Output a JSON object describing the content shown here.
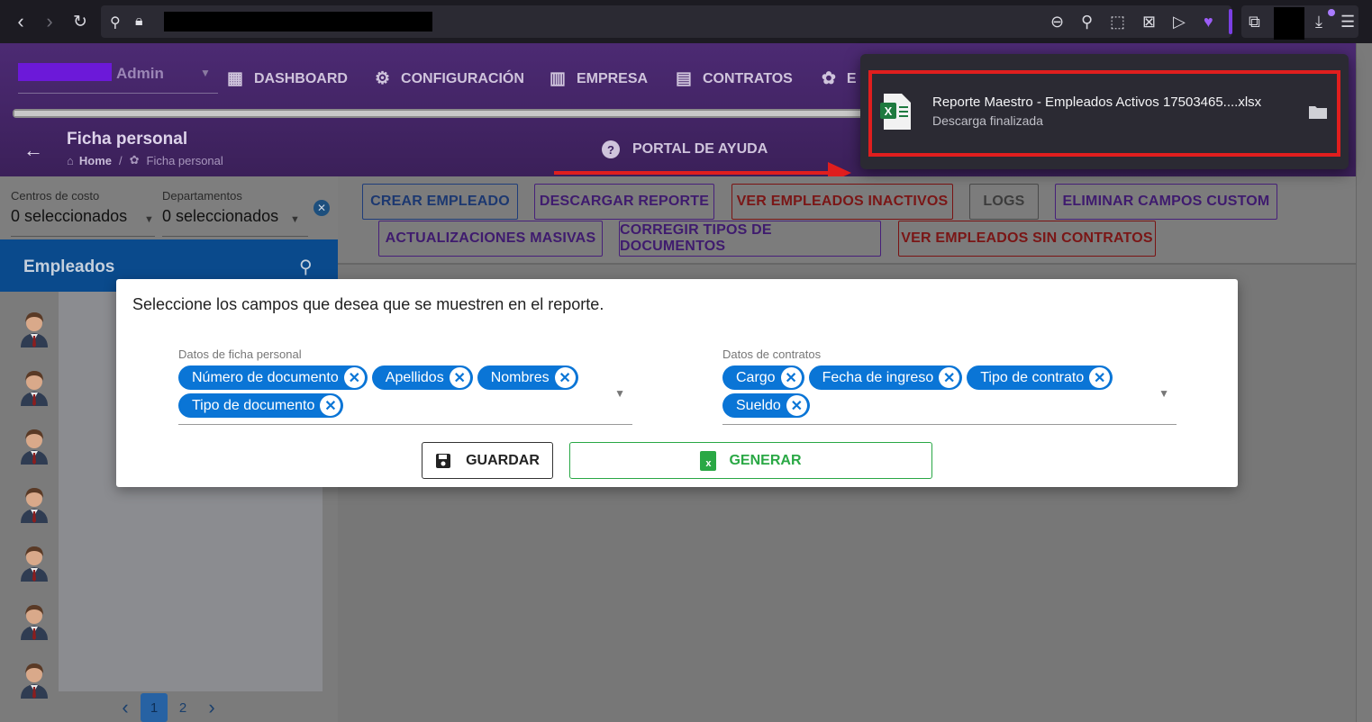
{
  "browser": {
    "url_redacted": true
  },
  "app": {
    "user_name": "Admin",
    "menu": [
      {
        "label": "DASHBOARD",
        "icon": "dashboard-icon"
      },
      {
        "label": "CONFIGURACIÓN",
        "icon": "gear-icon"
      },
      {
        "label": "EMPRESA",
        "icon": "building-icon"
      },
      {
        "label": "CONTRATOS",
        "icon": "clipboard-icon"
      },
      {
        "label": "E",
        "icon": "palette-icon"
      }
    ],
    "page_title": "Ficha personal",
    "breadcrumb": {
      "home": "Home",
      "current": "Ficha personal"
    },
    "help_portal": "PORTAL DE AYUDA"
  },
  "filters": {
    "centros_label": "Centros de costo",
    "centros_value": "0 seleccionados",
    "departamentos_label": "Departamentos",
    "departamentos_value": "0 seleccionados"
  },
  "employees": {
    "title": "Empleados",
    "avatar_count": 7,
    "pagination": {
      "prev": "‹",
      "pages": [
        "1",
        "2"
      ],
      "active": "1",
      "next": "›"
    }
  },
  "actions": {
    "crear": "CREAR EMPLEADO",
    "descargar": "DESCARGAR REPORTE",
    "inactivos": "VER EMPLEADOS INACTIVOS",
    "logs": "LOGS",
    "eliminar": "ELIMINAR CAMPOS CUSTOM",
    "actualizaciones": "ACTUALIZACIONES MASIVAS",
    "corregir": "CORREGIR TIPOS DE DOCUMENTOS",
    "sin_contratos": "VER EMPLEADOS SIN CONTRATOS"
  },
  "modal": {
    "title": "Seleccione los campos que desea que se muestren en el reporte.",
    "ficha": {
      "label": "Datos de ficha personal",
      "chips": [
        "Número de documento",
        "Apellidos",
        "Nombres",
        "Tipo de documento"
      ]
    },
    "contratos": {
      "label": "Datos de contratos",
      "chips": [
        "Cargo",
        "Fecha de ingreso",
        "Tipo de contrato",
        "Sueldo"
      ]
    },
    "guardar": "GUARDAR",
    "generar": "GENERAR"
  },
  "download": {
    "filename": "Reporte Maestro - Empleados Activos 17503465....xlsx",
    "status": "Descarga finalizada"
  },
  "colors": {
    "header": "#4c2a73",
    "chip": "#0a75d6",
    "highlight": "#e01e1e",
    "generar": "#28a745"
  }
}
